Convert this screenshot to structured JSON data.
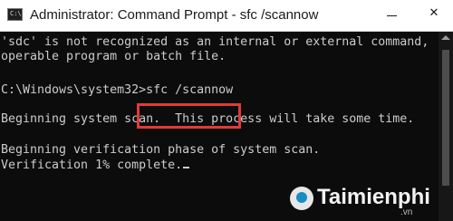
{
  "window": {
    "title": "Administrator: Command Prompt - sfc  /scannow",
    "icon_label": "C:\\",
    "minimize_glyph": "",
    "close_glyph": "✕"
  },
  "console": {
    "lines": [
      "'sdc' is not recognized as an internal or external command,",
      "operable program or batch file.",
      "C:\\Windows\\system32>sfc /scannow",
      "Beginning system scan.  This process will take some time.",
      "Beginning verification phase of system scan.",
      "Verification 1% complete."
    ],
    "highlighted_command": "sfc /scannow",
    "highlight_color": "#e23a3a",
    "text_color": "#cccccc",
    "background_color": "#0c0c0c"
  },
  "watermark": {
    "brand": "Taimienphi",
    "suffix": ".vn"
  }
}
